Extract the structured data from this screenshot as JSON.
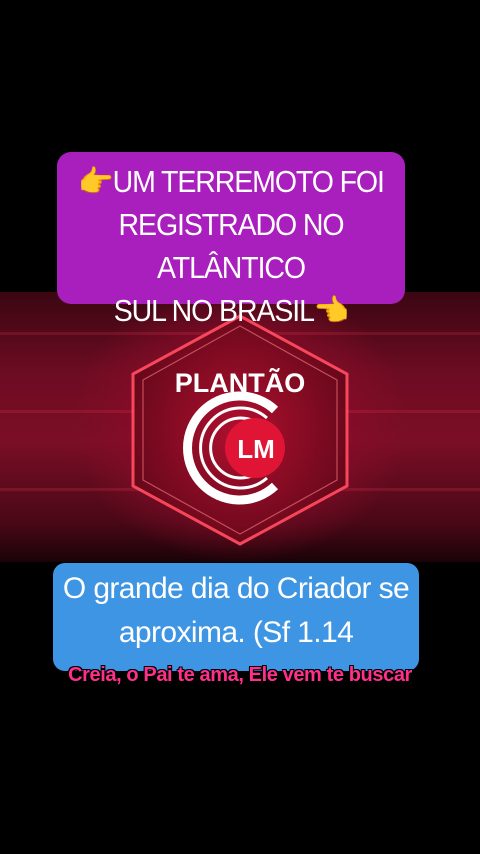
{
  "top_banner": {
    "line1": "👉UM TERREMOTO FOI",
    "line2": "REGISTRADO NO ATLÂNTICO",
    "line3": "SUL NO BRASIL👈"
  },
  "logo": {
    "heading": "PLANTÃO",
    "monogram": "LM"
  },
  "blue_bubble": {
    "line1": "O grande dia do Criador se",
    "line2": "aproxima. (Sf 1.14"
  },
  "caption": "Creia, o Pai te ama, Ele vem te buscar",
  "colors": {
    "banner_purple": "#a91fbd",
    "bubble_blue": "#3e95e3",
    "caption_pink": "#ff2f8a",
    "logo_red": "#e01535"
  }
}
